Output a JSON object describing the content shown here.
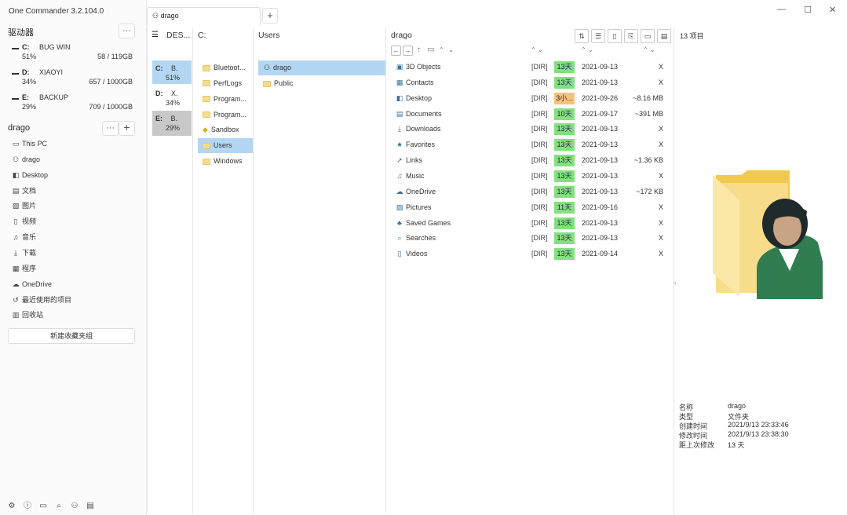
{
  "app": {
    "title": "One Commander 3.2.104.0"
  },
  "drives_section": {
    "heading": "驱动器",
    "more_label": "···",
    "drives": [
      {
        "letter": "C:",
        "label": "BUG WIN",
        "percent": "51%",
        "size": "58 / 119GB"
      },
      {
        "letter": "D:",
        "label": "XIAOYI",
        "percent": "34%",
        "size": "657 / 1000GB"
      },
      {
        "letter": "E:",
        "label": "BACKUP",
        "percent": "29%",
        "size": "709 / 1000GB"
      }
    ]
  },
  "favorites_section": {
    "heading": "drago",
    "more_label": "···",
    "add_label": "+",
    "items": [
      {
        "label": "This PC",
        "icon": "monitor-icon",
        "glyph": "▭"
      },
      {
        "label": "drago",
        "icon": "person-icon",
        "glyph": "⚇"
      },
      {
        "label": "Desktop",
        "icon": "desktop-icon",
        "glyph": "◧"
      },
      {
        "label": "文档",
        "icon": "document-icon",
        "glyph": "▤"
      },
      {
        "label": "图片",
        "icon": "picture-icon",
        "glyph": "▨"
      },
      {
        "label": "视频",
        "icon": "video-icon",
        "glyph": "▯"
      },
      {
        "label": "音乐",
        "icon": "music-icon",
        "glyph": "♫"
      },
      {
        "label": "下载",
        "icon": "download-icon",
        "glyph": "⤓"
      },
      {
        "label": "程序",
        "icon": "apps-icon",
        "glyph": "▦"
      },
      {
        "label": "OneDrive",
        "icon": "cloud-icon",
        "glyph": "☁"
      },
      {
        "label": "最近使用的项目",
        "icon": "recent-icon",
        "glyph": "↺"
      },
      {
        "label": "回收站",
        "icon": "trash-icon",
        "glyph": "▥"
      }
    ],
    "new_group_label": "新建收藏夹组"
  },
  "bottom_toolbar": [
    {
      "icon": "settings-icon",
      "glyph": "⚙"
    },
    {
      "icon": "info-icon",
      "glyph": "ⓘ"
    },
    {
      "icon": "layout-icon",
      "glyph": "▭"
    },
    {
      "icon": "search-icon",
      "glyph": "⌕"
    },
    {
      "icon": "user-icon",
      "glyph": "⚇"
    },
    {
      "icon": "window-icon",
      "glyph": "▤"
    }
  ],
  "tabs": [
    {
      "label": "drago",
      "icon": "person-icon"
    }
  ],
  "tab_add_label": "+",
  "window_controls": {
    "minimize": "—",
    "maximize": "☐",
    "close": "✕"
  },
  "columns": {
    "col1": {
      "header": "DES...",
      "rows": [
        {
          "letter": "C:",
          "name": "B.",
          "percent": "51%"
        },
        {
          "letter": "D:",
          "name": "X.",
          "percent": "34%"
        },
        {
          "letter": "E:",
          "name": "B.",
          "percent": "29%"
        }
      ]
    },
    "col2": {
      "header": "C:",
      "rows": [
        "Bluetoot...",
        "PerfLogs",
        "Program...",
        "Program...",
        "Sandbox",
        "Users",
        "Windows"
      ]
    },
    "col3": {
      "header": "Users",
      "rows": [
        "drago",
        "Public"
      ]
    }
  },
  "main_list": {
    "header": "drago",
    "item_count": "13 项目",
    "rows": [
      {
        "name": "3D Objects",
        "icon": "cube-icon",
        "glyph": "▣",
        "type": "[DIR]",
        "age": "13天",
        "date": "2021-09-13",
        "size": "X"
      },
      {
        "name": "Contacts",
        "icon": "contacts-icon",
        "glyph": "▦",
        "type": "[DIR]",
        "age": "13天",
        "date": "2021-09-13",
        "size": "X"
      },
      {
        "name": "Desktop",
        "icon": "desktop-icon",
        "glyph": "◧",
        "type": "[DIR]",
        "age": "3小...",
        "date": "2021-09-26",
        "size": "~8.16 MB"
      },
      {
        "name": "Documents",
        "icon": "document-icon",
        "glyph": "▤",
        "type": "[DIR]",
        "age": "10天",
        "date": "2021-09-17",
        "size": "~391 MB"
      },
      {
        "name": "Downloads",
        "icon": "download-icon",
        "glyph": "⤓",
        "type": "[DIR]",
        "age": "13天",
        "date": "2021-09-13",
        "size": "X"
      },
      {
        "name": "Favorites",
        "icon": "star-icon",
        "glyph": "★",
        "type": "[DIR]",
        "age": "13天",
        "date": "2021-09-13",
        "size": "X"
      },
      {
        "name": "Links",
        "icon": "link-icon",
        "glyph": "➚",
        "type": "[DIR]",
        "age": "13天",
        "date": "2021-09-13",
        "size": "~1.36 KB"
      },
      {
        "name": "Music",
        "icon": "music-icon",
        "glyph": "♫",
        "type": "[DIR]",
        "age": "13天",
        "date": "2021-09-13",
        "size": "X"
      },
      {
        "name": "OneDrive",
        "icon": "cloud-icon",
        "glyph": "☁",
        "type": "[DIR]",
        "age": "13天",
        "date": "2021-09-13",
        "size": "~172 KB"
      },
      {
        "name": "Pictures",
        "icon": "picture-icon",
        "glyph": "▨",
        "type": "[DIR]",
        "age": "11天",
        "date": "2021-09-16",
        "size": "X"
      },
      {
        "name": "Saved Games",
        "icon": "gamepad-icon",
        "glyph": "♣",
        "type": "[DIR]",
        "age": "13天",
        "date": "2021-09-13",
        "size": "X"
      },
      {
        "name": "Searches",
        "icon": "search-icon",
        "glyph": "⌕",
        "type": "[DIR]",
        "age": "13天",
        "date": "2021-09-13",
        "size": "X"
      },
      {
        "name": "Videos",
        "icon": "video-icon",
        "glyph": "▯",
        "type": "[DIR]",
        "age": "13天",
        "date": "2021-09-14",
        "size": "X"
      }
    ]
  },
  "properties": [
    {
      "key": "名称",
      "value": "drago"
    },
    {
      "key": "类型",
      "value": "文件夹"
    },
    {
      "key": "创建时间",
      "value": "2021/9/13 23:33:46"
    },
    {
      "key": "修改时间",
      "value": "2021/9/13 23:38:30"
    },
    {
      "key": "距上次修改",
      "value": "13 天"
    }
  ],
  "colors": {
    "selection": "#b3d7f3",
    "age_recent": "#84e07f",
    "age_fresh": "#f7c37a",
    "folder": "#f7dc8c"
  }
}
